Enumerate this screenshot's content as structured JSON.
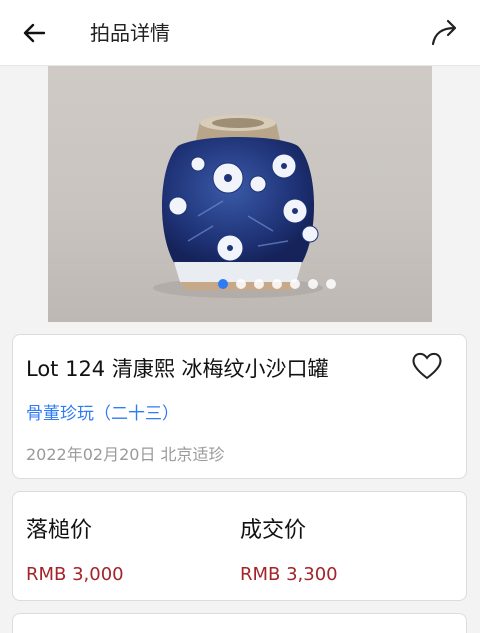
{
  "header": {
    "title": "拍品详情",
    "back_icon": "arrow-left-icon",
    "share_icon": "share-arrow-icon"
  },
  "gallery": {
    "image": "blue-and-white-porcelain-jar-photo",
    "dot_count": 7,
    "active_index": 0,
    "active_color": "#2f7bf5"
  },
  "lot": {
    "title": "Lot 124 清康熙 冰梅纹小沙口罐",
    "category": "骨董珍玩（二十三）",
    "meta": "2022年02月20日 北京适珍",
    "favorite_icon": "heart-outline-icon"
  },
  "prices": {
    "hammer_label": "落槌价",
    "hammer_value": "RMB 3,000",
    "deal_label": "成交价",
    "deal_value": "RMB 3,300",
    "price_color": "#a3242a"
  }
}
